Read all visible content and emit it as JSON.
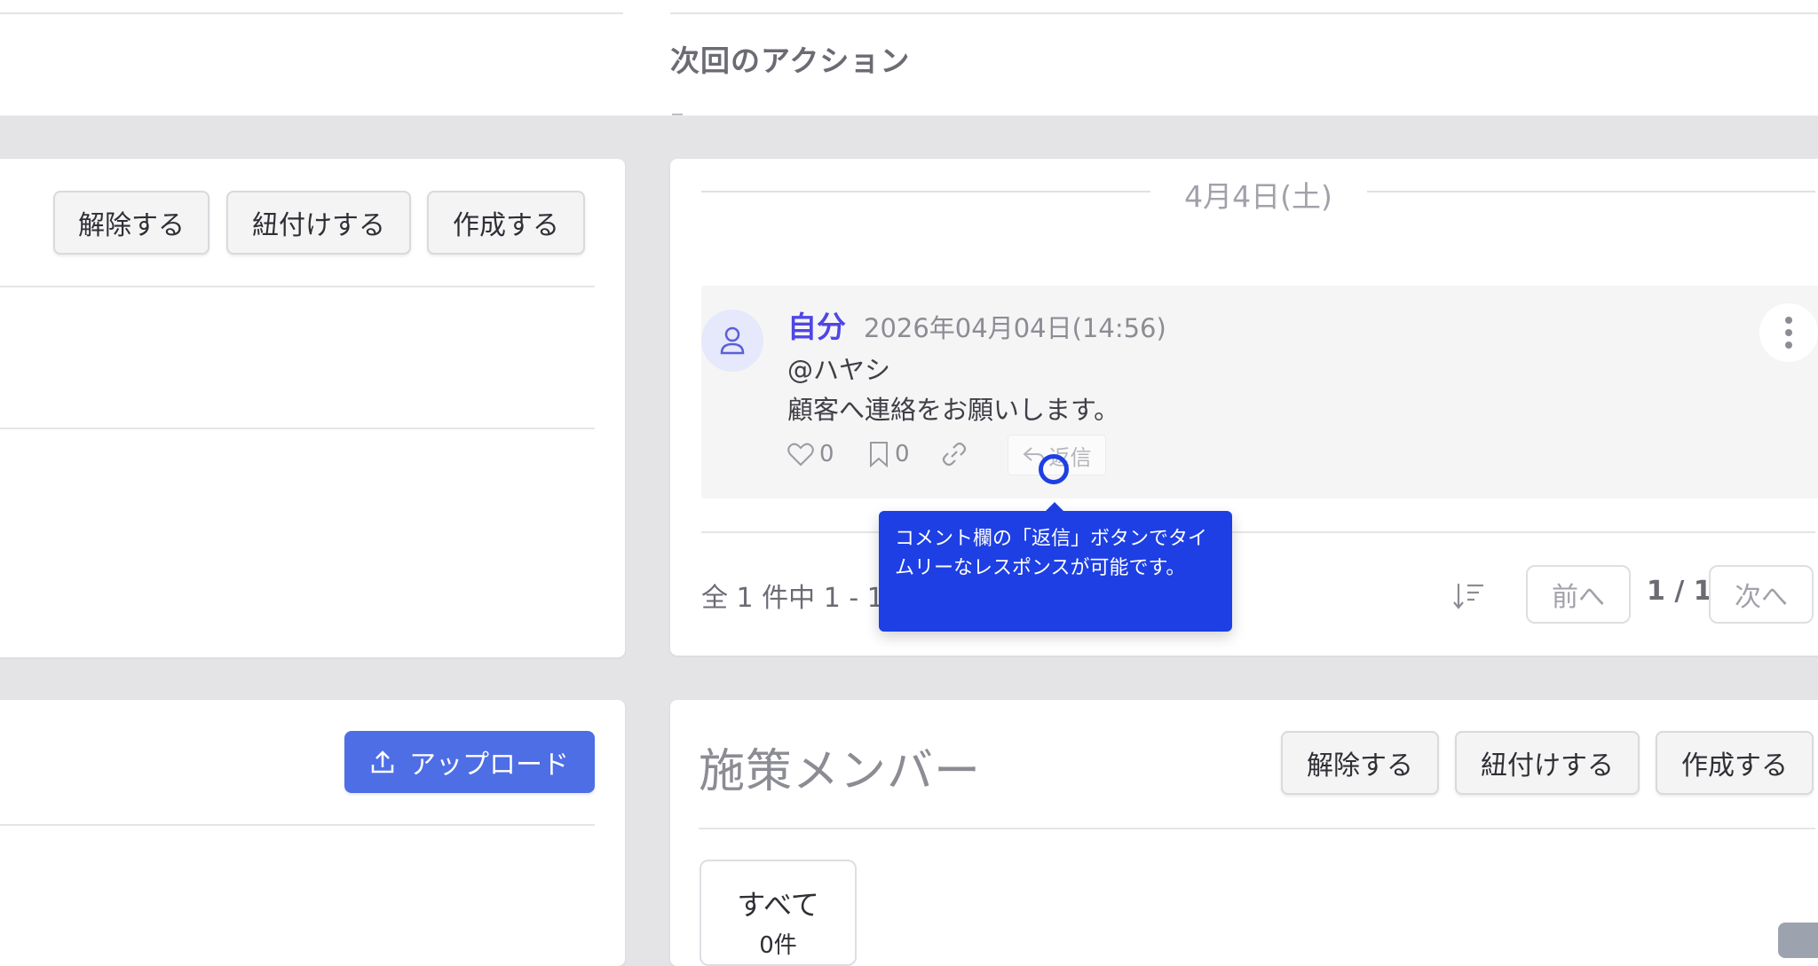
{
  "header": {
    "next_action_title": "次回のアクション"
  },
  "left_card_top": {
    "buttons": {
      "release": "解除する",
      "link": "紐付けする",
      "create": "作成する"
    }
  },
  "comments_card": {
    "date_label": "4月4日(土)",
    "comment": {
      "author": "自分",
      "timestamp": "2026年04月04日(14:56)",
      "mention": "@ハヤシ",
      "text": "顧客へ連絡をお願いします。",
      "likes": "0",
      "bookmarks": "0",
      "reply_label": "返信"
    },
    "count_label": "全 1 件中 1 - 1 件",
    "pager": {
      "prev": "前へ",
      "page": "1 / 1",
      "next": "次へ"
    }
  },
  "tooltip": {
    "text": "コメント欄の「返信」ボタンでタイムリーなレスポンスが可能です。"
  },
  "left_card_bottom": {
    "upload_label": "アップロード"
  },
  "members_card": {
    "title": "施策メンバー",
    "buttons": {
      "release": "解除する",
      "link": "紐付けする",
      "create": "作成する"
    },
    "filter_all": {
      "label": "すべて",
      "count": "0件"
    }
  },
  "colors": {
    "accent": "#4f46e5",
    "tooltip_bg": "#1d3fe3",
    "upload_bg": "#4e6ee6"
  }
}
